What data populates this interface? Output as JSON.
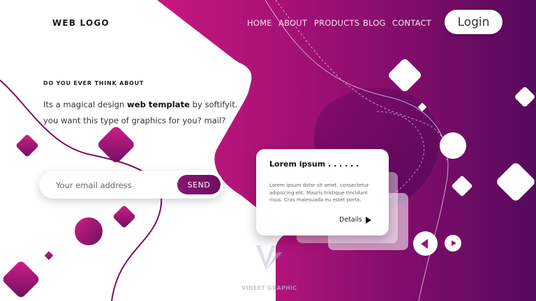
{
  "brand": {
    "logo": "WEB LOGO"
  },
  "nav": {
    "items": [
      {
        "label": "HOME"
      },
      {
        "label": "ABOUT"
      },
      {
        "label": "PRODUCTS"
      },
      {
        "label": "BLOG"
      },
      {
        "label": "CONTACT"
      }
    ]
  },
  "header": {
    "login_label": "Login"
  },
  "hero": {
    "eyebrow": "DO YOU EVER THINK ABOUT",
    "line1_before": "Its a magical design ",
    "line1_strong": "web template",
    "line1_after": " by softifyit.",
    "line2": "you want this type of graphics for you? mail?"
  },
  "subscribe": {
    "placeholder": "Your email address",
    "value": "",
    "send_label": "SEND"
  },
  "card": {
    "title": "Lorem ipsum . . . . . .",
    "body": "Lorem ipsum dolor sit amet, consectetur adipiscing elit. Mauris tristique tincidunt risus. Cras malesuada eu estet porta.",
    "details_label": "Details"
  },
  "watermark": {
    "text": "VINEET GRAPHIC"
  },
  "colors": {
    "accent_dark": "#5c0a5e",
    "accent": "#9a0f72",
    "accent_light": "#c81a7e"
  },
  "icons": {
    "details": "triangle-right-icon",
    "prev": "triangle-left-icon",
    "next": "triangle-right-icon"
  }
}
